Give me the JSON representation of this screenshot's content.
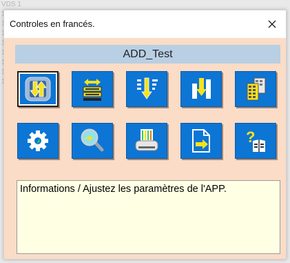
{
  "background_text": "VDS 1 1 1 1 1 1 1 1 1 1 1 1 1 1 1 1 1 1 1 1 1 1 1 1",
  "window": {
    "title": "Controles en francés.",
    "close_symbol": "✕"
  },
  "header": {
    "label": "ADD_Test"
  },
  "buttons": [
    {
      "name": "import-export-icon",
      "active": true
    },
    {
      "name": "transfer-list-icon",
      "active": false
    },
    {
      "name": "filter-sort-icon",
      "active": false
    },
    {
      "name": "chart-download-icon",
      "active": false
    },
    {
      "name": "document-grid-icon",
      "active": false
    },
    {
      "name": "gear-icon",
      "active": false
    },
    {
      "name": "magnifier-icon",
      "active": false
    },
    {
      "name": "printer-icon",
      "active": false
    },
    {
      "name": "file-export-icon",
      "active": false
    },
    {
      "name": "help-book-icon",
      "active": false
    }
  ],
  "info": {
    "text": "Informations / Ajustez les paramètres de l'APP."
  },
  "colors": {
    "button_blue": "#0d75d4",
    "window_bg": "#fbdcc6",
    "header_bg": "#b8cfe4",
    "info_bg": "#ffffe4"
  }
}
